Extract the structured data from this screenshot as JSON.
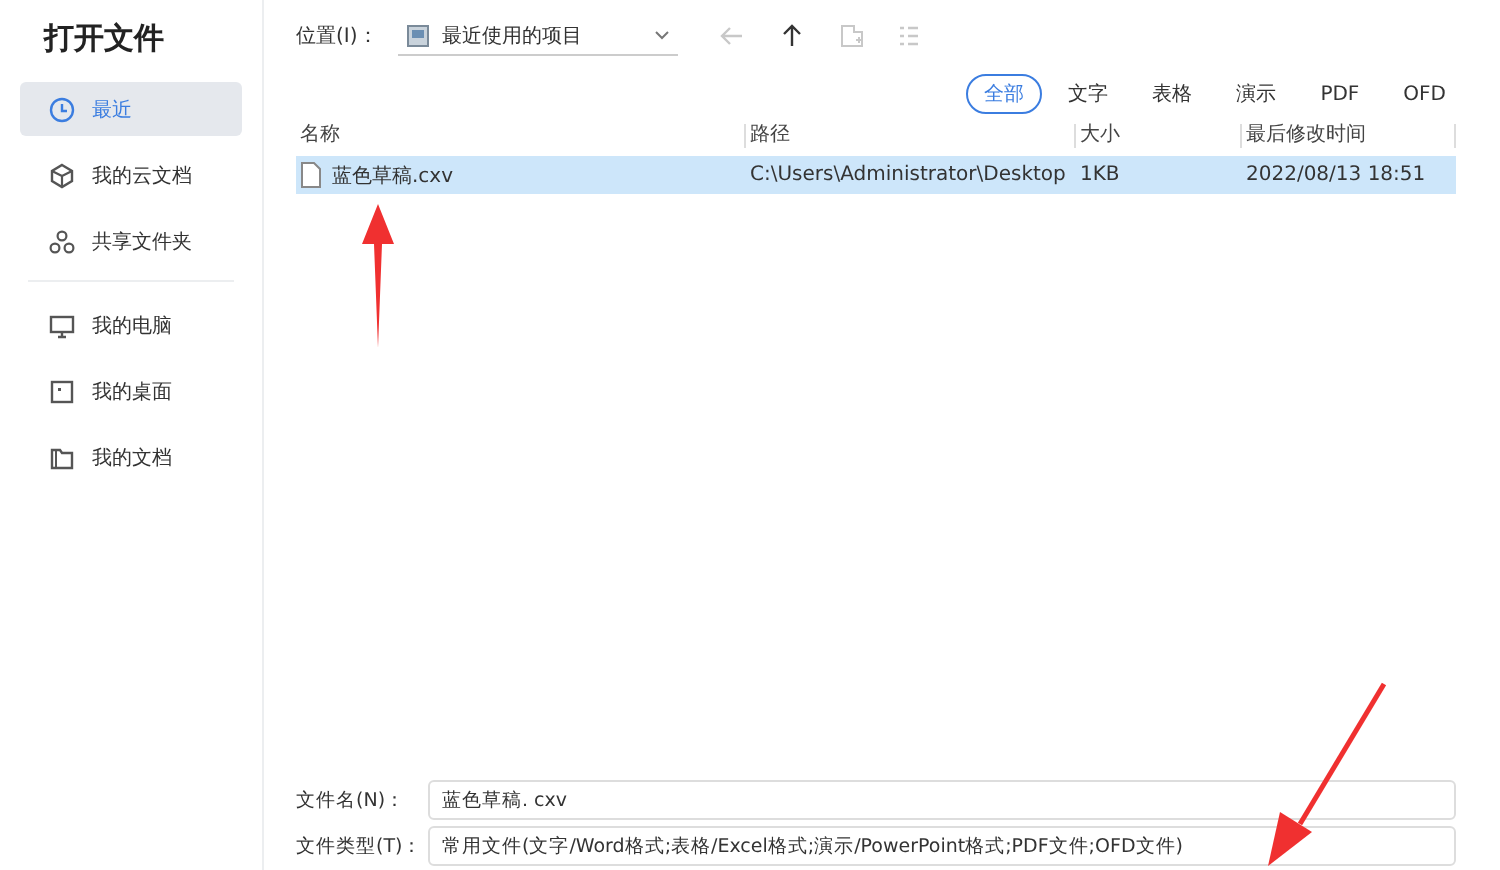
{
  "title": "打开文件",
  "sidebar": {
    "groups": [
      [
        {
          "label": "最近",
          "kind": "clock",
          "selected": true
        },
        {
          "label": "我的云文档",
          "kind": "cloud",
          "selected": false
        },
        {
          "label": "共享文件夹",
          "kind": "share",
          "selected": false
        }
      ],
      [
        {
          "label": "我的电脑",
          "kind": "computer",
          "selected": false
        },
        {
          "label": "我的桌面",
          "kind": "desktop",
          "selected": false
        },
        {
          "label": "我的文档",
          "kind": "documents",
          "selected": false
        }
      ]
    ]
  },
  "location": {
    "label": "位置(I)：",
    "value": "最近使用的项目"
  },
  "toolbar": [
    {
      "kind": "back",
      "disabled": true
    },
    {
      "kind": "up",
      "disabled": false
    },
    {
      "kind": "new-folder",
      "disabled": true
    },
    {
      "kind": "view",
      "disabled": true
    }
  ],
  "filters": [
    {
      "label": "全部",
      "selected": true
    },
    {
      "label": "文字",
      "selected": false
    },
    {
      "label": "表格",
      "selected": false
    },
    {
      "label": "演示",
      "selected": false
    },
    {
      "label": "PDF",
      "selected": false
    },
    {
      "label": "OFD",
      "selected": false
    }
  ],
  "table": {
    "columns": [
      "名称",
      "路径",
      "大小",
      "最后修改时间"
    ],
    "rows": [
      {
        "name": "蓝色草稿.cxv",
        "path": "C:\\Users\\Administrator\\Desktop",
        "size": "1KB",
        "modified": "2022/08/13 18:51",
        "selected": true
      }
    ]
  },
  "file_name": {
    "label": "文件名(N)：",
    "value": "蓝色草稿. cxv"
  },
  "file_type": {
    "label": "文件类型(T)：",
    "value": "常用文件(文字/Word格式;表格/Excel格式;演示/PowerPoint格式;PDF文件;OFD文件)"
  }
}
